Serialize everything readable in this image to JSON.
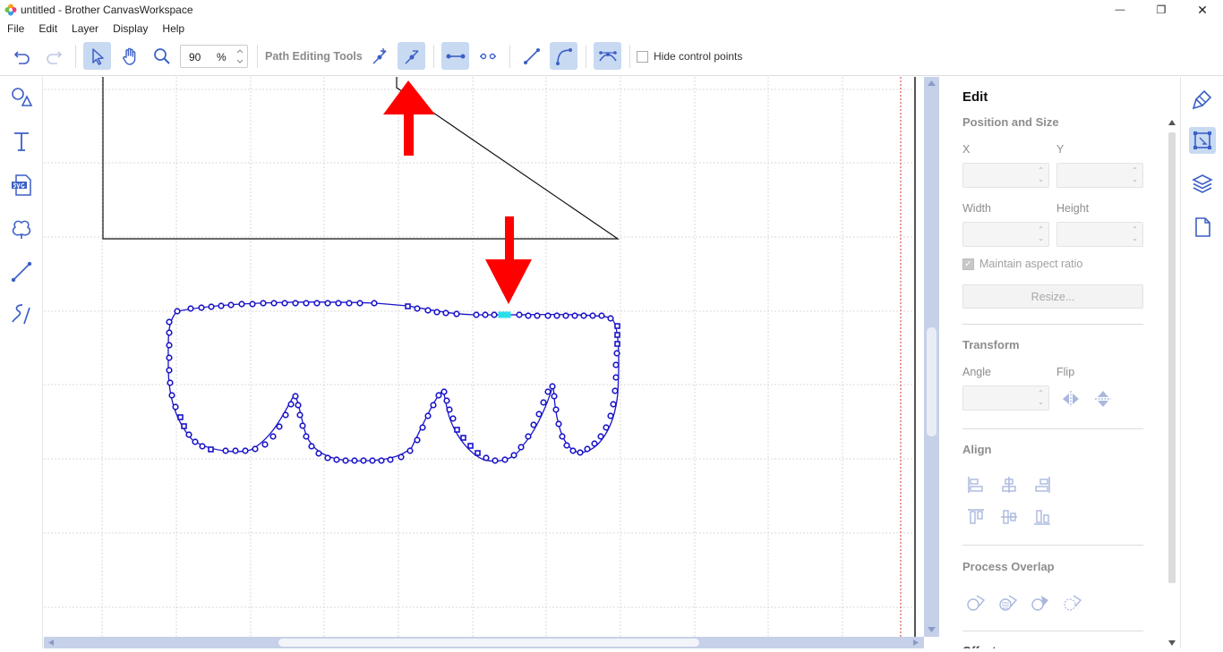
{
  "window": {
    "title": "untitled - Brother CanvasWorkspace",
    "minimize_glyph": "—",
    "restore_glyph": "❐",
    "close_glyph": "✕"
  },
  "menu": [
    "File",
    "Edit",
    "Layer",
    "Display",
    "Help"
  ],
  "toolbar": {
    "zoom_value": "90",
    "zoom_unit": "%",
    "path_editing_label": "Path Editing Tools",
    "hide_control_points_label": "Hide control points",
    "hide_control_points_checked": false,
    "icons": {
      "undo": "undo-icon",
      "redo": "redo-icon",
      "select": "select-arrow-icon",
      "pan": "hand-icon",
      "zoom": "magnifier-icon",
      "add_point": "add-point-icon",
      "delete_point": "delete-point-icon",
      "join_points": "join-points-icon",
      "split_point": "split-point-icon",
      "straight_line": "straight-line-icon",
      "curve": "curve-icon",
      "smooth": "smooth-point-icon"
    },
    "active_tools": [
      "select",
      "delete_point",
      "join_points",
      "curve",
      "smooth"
    ]
  },
  "left_tools": [
    "shapes-icon",
    "text-icon",
    "svg-import-icon",
    "pattern-icon",
    "line-icon",
    "freehand-icon"
  ],
  "panel": {
    "title": "Edit",
    "position_size": {
      "section": "Position and Size",
      "x_label": "X",
      "y_label": "Y",
      "width_label": "Width",
      "height_label": "Height",
      "maintain_aspect_label": "Maintain aspect ratio",
      "maintain_aspect_checked": true,
      "resize_label": "Resize..."
    },
    "transform": {
      "section": "Transform",
      "angle_label": "Angle",
      "flip_label": "Flip"
    },
    "align": {
      "section": "Align"
    },
    "process_overlap": {
      "section": "Process Overlap"
    },
    "offset": {
      "section": "Offset"
    }
  },
  "right_tools": [
    "edit-paintbrush-icon",
    "edit-transform-icon",
    "layers-icon",
    "page-icon"
  ],
  "colors": {
    "accent": "#3b5fc6",
    "active_bg": "#c8d9f2",
    "path_points": "#1a14c8",
    "selected_point": "#29e0ea",
    "arrow": "#ff0000",
    "scroll_track": "#c6d0e8"
  }
}
